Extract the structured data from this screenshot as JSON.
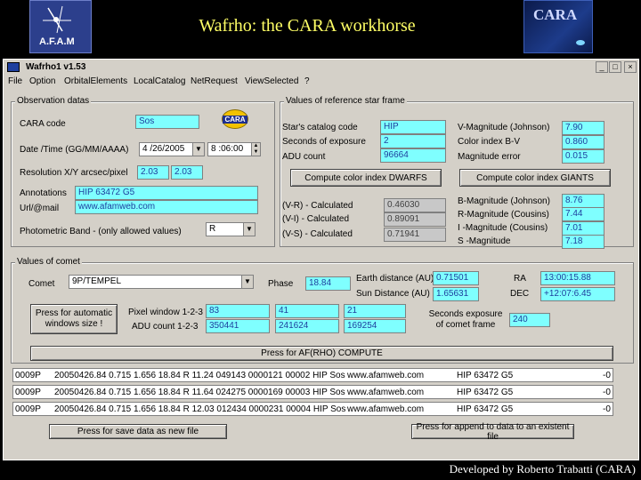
{
  "slide": {
    "title": "Wafrho: the CARA workhorse",
    "footer": "Developed by Roberto Trabatti (CARA)",
    "logo_left_text": "A.F.A.M",
    "logo_right_text": "CARA"
  },
  "window": {
    "title": "Wafrho1 v1.53",
    "menu": [
      "File",
      "Option",
      "OrbitalElements",
      "LocalCatalog",
      "NetRequest",
      "ViewSelected",
      "?"
    ],
    "minimize": "_",
    "maximize": "□",
    "close": "×"
  },
  "observation": {
    "group_label": "Observation datas",
    "cara_code_label": "CARA code",
    "cara_code": "Sos",
    "date_label": "Date /Time (GG/MM/AAAA)",
    "date": "4 /26/2005",
    "time": "8 :06:00",
    "resolution_label": "Resolution X/Y arcsec/pixel",
    "res_x": "2.03",
    "res_y": "2.03",
    "annotations_label": "Annotations",
    "annotations": "HIP 63472 G5",
    "url_label": "Url/@mail",
    "url": "www.afamweb.com",
    "band_label": "Photometric Band  - (only allowed values)",
    "band": "R",
    "cara_logo": "CARA"
  },
  "reference": {
    "group_label": "Values of reference star frame",
    "catalog_label": "Star's catalog code",
    "catalog": "HIP",
    "exposure_label": "Seconds of exposure",
    "exposure": "2",
    "adu_label": "ADU count",
    "adu": "96664",
    "vmag_label": "V-Magnitude (Johnson)",
    "vmag": "7.90",
    "bv_label": "Color index B-V",
    "bv": "0.860",
    "magerr_label": "Magnitude error",
    "magerr": "0.015",
    "dwarfs_button": "Compute color index DWARFS",
    "giants_button": "Compute color index GIANTS",
    "vr_label": "(V-R) - Calculated",
    "vr": "0.46030",
    "vi_label": "(V-I) -  Calculated",
    "vi": "0.89091",
    "vs_label": "(V-S) - Calculated",
    "vs": "0.71941",
    "bmag_label": "B-Magnitude (Johnson)",
    "bmag": "8.76",
    "rmag_label": "R-Magnitude (Cousins)",
    "rmag": "7.44",
    "imag_label": "I -Magnitude (Cousins)",
    "imag": "7.01",
    "smag_label": "S -Magnitude",
    "smag": "7.18"
  },
  "comet": {
    "group_label": "Values of comet",
    "comet_label": "Comet",
    "comet": "9P/TEMPEL",
    "phase_label": "Phase",
    "phase": "18.84",
    "earth_label": "Earth distance (AU)",
    "earth": "0.71501",
    "sun_label": "Sun Distance (AU)",
    "sun": "1.65631",
    "ra_label": "RA",
    "ra": "13:00:15.88",
    "dec_label": "DEC",
    "dec": "+12:07:6.45",
    "auto_button": "Press for automatic windows size !",
    "pixel_label": "Pixel window 1-2-3",
    "px1": "83",
    "px2": "41",
    "px3": "21",
    "adu_label": "ADU count 1-2-3",
    "adu1": "350441",
    "adu2": "241624",
    "adu3": "169254",
    "exp_label": "Seconds exposure of comet frame",
    "exp": "240",
    "compute_button": "Press for AF(RHO) COMPUTE"
  },
  "results": [
    {
      "code": "0009P",
      "data": "20050426.84 0.715 1.656 18.84 R  11.24 049143 0000121 00002 HIP Sos",
      "url": "www.afamweb.com",
      "note": "HIP 63472 G5",
      "end": "-0"
    },
    {
      "code": "0009P",
      "data": "20050426.84 0.715 1.656 18.84 R  11.64 024275 0000169 00003 HIP Sos",
      "url": "www.afamweb.com",
      "note": "HIP 63472 G5",
      "end": "-0"
    },
    {
      "code": "0009P",
      "data": "20050426.84 0.715 1.656 18.84 R  12.03 012434 0000231 00004 HIP Sos",
      "url": "www.afamweb.com",
      "note": "HIP 63472 G5",
      "end": "-0"
    }
  ],
  "bottom": {
    "save_new": "Press for save data as new file",
    "append": "Press for append to  data to an existent file"
  }
}
